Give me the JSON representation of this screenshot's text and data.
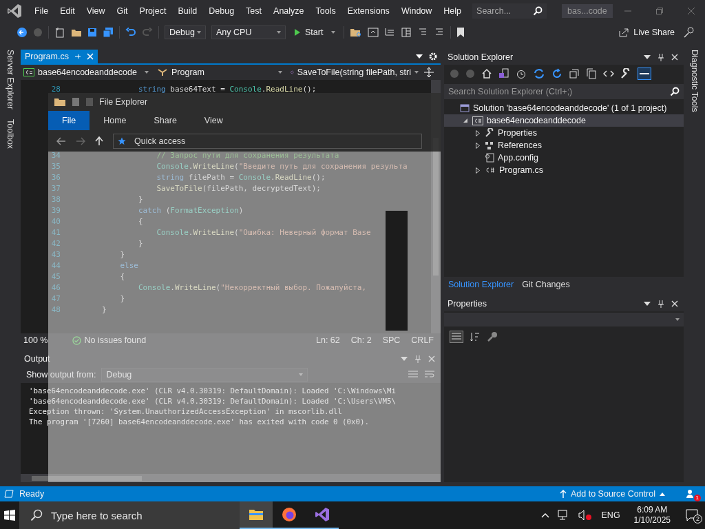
{
  "title_bar": {
    "menu": [
      "File",
      "Edit",
      "View",
      "Git",
      "Project",
      "Build",
      "Debug",
      "Test",
      "Analyze",
      "Tools",
      "Extensions",
      "Window",
      "Help"
    ],
    "search": {
      "placeholder": "Search..."
    },
    "solution_name": "bas...code"
  },
  "toolbar": {
    "configuration": "Debug",
    "platform": "Any CPU",
    "start": "Start",
    "live_share": "Live Share"
  },
  "left_strip": [
    "Server Explorer",
    "Toolbox"
  ],
  "editor": {
    "tabs": [
      {
        "label": "Program.cs",
        "selected": true
      }
    ],
    "nav": {
      "project": "base64encodeanddecode",
      "class": "Program",
      "member": "SaveToFile(string filePath, stri"
    },
    "lines": [
      {
        "num": "28",
        "tokens": [
          {
            "kind": "keyword",
            "text": "                string"
          },
          {
            "kind": "plain",
            "text": " base64Text = "
          },
          {
            "kind": "type",
            "text": "Console"
          },
          {
            "kind": "plain",
            "text": "."
          },
          {
            "kind": "method",
            "text": "ReadLine"
          },
          {
            "kind": "plain",
            "text": "();"
          }
        ]
      },
      {
        "num": "34",
        "tokens": [
          {
            "kind": "comment",
            "text": "                    // Запрос пути для сохранения результата"
          }
        ]
      },
      {
        "num": "35",
        "tokens": [
          {
            "kind": "type",
            "text": "                    Console"
          },
          {
            "kind": "plain",
            "text": "."
          },
          {
            "kind": "method",
            "text": "WriteLine"
          },
          {
            "kind": "plain",
            "text": "("
          },
          {
            "kind": "string",
            "text": "\"Введите путь для сохранения результа"
          }
        ]
      },
      {
        "num": "36",
        "tokens": [
          {
            "kind": "keyword",
            "text": "                    string"
          },
          {
            "kind": "plain",
            "text": " filePath = "
          },
          {
            "kind": "type",
            "text": "Console"
          },
          {
            "kind": "plain",
            "text": "."
          },
          {
            "kind": "method",
            "text": "ReadLine"
          },
          {
            "kind": "plain",
            "text": "();"
          }
        ]
      },
      {
        "num": "37",
        "tokens": [
          {
            "kind": "method",
            "text": "                    SaveToFile"
          },
          {
            "kind": "plain",
            "text": "(filePath, decryptedText);"
          }
        ]
      },
      {
        "num": "38",
        "tokens": [
          {
            "kind": "plain",
            "text": "                }"
          }
        ]
      },
      {
        "num": "39",
        "tokens": [
          {
            "kind": "keyword",
            "text": "                catch"
          },
          {
            "kind": "plain",
            "text": " ("
          },
          {
            "kind": "type",
            "text": "FormatException"
          },
          {
            "kind": "plain",
            "text": ")"
          }
        ]
      },
      {
        "num": "40",
        "tokens": [
          {
            "kind": "plain",
            "text": "                {"
          }
        ]
      },
      {
        "num": "41",
        "tokens": [
          {
            "kind": "type",
            "text": "                    Console"
          },
          {
            "kind": "plain",
            "text": "."
          },
          {
            "kind": "method",
            "text": "WriteLine"
          },
          {
            "kind": "plain",
            "text": "("
          },
          {
            "kind": "string",
            "text": "\"Ошибка: Неверный формат Base"
          }
        ]
      },
      {
        "num": "42",
        "tokens": [
          {
            "kind": "plain",
            "text": "                }"
          }
        ]
      },
      {
        "num": "43",
        "tokens": [
          {
            "kind": "plain",
            "text": "            }"
          }
        ]
      },
      {
        "num": "44",
        "tokens": [
          {
            "kind": "keyword",
            "text": "            else"
          }
        ]
      },
      {
        "num": "45",
        "tokens": [
          {
            "kind": "plain",
            "text": "            {"
          }
        ]
      },
      {
        "num": "46",
        "tokens": [
          {
            "kind": "type",
            "text": "                Console"
          },
          {
            "kind": "plain",
            "text": "."
          },
          {
            "kind": "method",
            "text": "WriteLine"
          },
          {
            "kind": "plain",
            "text": "("
          },
          {
            "kind": "string",
            "text": "\"Некорректный выбор. Пожалуйста,"
          }
        ]
      },
      {
        "num": "47",
        "tokens": [
          {
            "kind": "plain",
            "text": "            }"
          }
        ]
      },
      {
        "num": "48",
        "tokens": [
          {
            "kind": "plain",
            "text": "        }"
          }
        ]
      }
    ],
    "status": {
      "zoom": "100 %",
      "issues": "No issues found",
      "line": "Ln: 62",
      "column": "Ch: 2",
      "spacing": "SPC",
      "line_ending": "CRLF"
    }
  },
  "output": {
    "title": "Output",
    "source_label": "Show output from:",
    "source": "Debug",
    "lines": [
      "'base64encodeanddecode.exe' (CLR v4.0.30319: DefaultDomain): Loaded 'C:\\Windows\\Mi",
      "'base64encodeanddecode.exe' (CLR v4.0.30319: DefaultDomain): Loaded 'C:\\Users\\VM5\\",
      "Exception thrown: 'System.UnauthorizedAccessException' in mscorlib.dll",
      "The program '[7260] base64encodeanddecode.exe' has exited with code 0 (0x0)."
    ]
  },
  "solution_explorer": {
    "title": "Solution Explorer",
    "search": {
      "placeholder": "Search Solution Explorer (Ctrl+;)"
    },
    "tree": [
      {
        "label": "Solution 'base64encodeanddecode' (1 of 1 project)",
        "kind": "solution",
        "selected": false,
        "children": [
          {
            "label": "base64encodeanddecode",
            "kind": "project",
            "expanded": true,
            "selected": true,
            "children": [
              {
                "label": "Properties",
                "kind": "properties",
                "expanded": false,
                "selected": false
              },
              {
                "label": "References",
                "kind": "references",
                "expanded": false,
                "selected": false
              },
              {
                "label": "App.config",
                "kind": "config",
                "selected": false
              },
              {
                "label": "Program.cs",
                "kind": "csharp",
                "expanded": false,
                "selected": false
              }
            ]
          }
        ]
      }
    ]
  },
  "panel_tabs": [
    {
      "label": "Solution Explorer",
      "selected": true
    },
    {
      "label": "Git Changes",
      "selected": false
    }
  ],
  "properties": {
    "title": "Properties"
  },
  "right_strip": [
    "Diagnostic Tools"
  ],
  "file_explorer": {
    "title": "File Explorer",
    "ribbon_tabs": [
      {
        "label": "File",
        "selected": true
      },
      {
        "label": "Home",
        "selected": false
      },
      {
        "label": "Share",
        "selected": false
      },
      {
        "label": "View",
        "selected": false
      }
    ],
    "address": "Quick access"
  },
  "status_bar": {
    "state": "Ready",
    "source_control": "Add to Source Control",
    "notifications": "1"
  },
  "taskbar": {
    "search": {
      "placeholder": "Type here to search"
    },
    "apps": [
      {
        "kind": "file-explorer",
        "selected": true
      },
      {
        "kind": "firefox",
        "selected": false
      },
      {
        "kind": "visual-studio",
        "selected": false
      }
    ],
    "language": "ENG",
    "time": "6:09 AM",
    "date": "1/10/2025",
    "notifications": "2"
  }
}
